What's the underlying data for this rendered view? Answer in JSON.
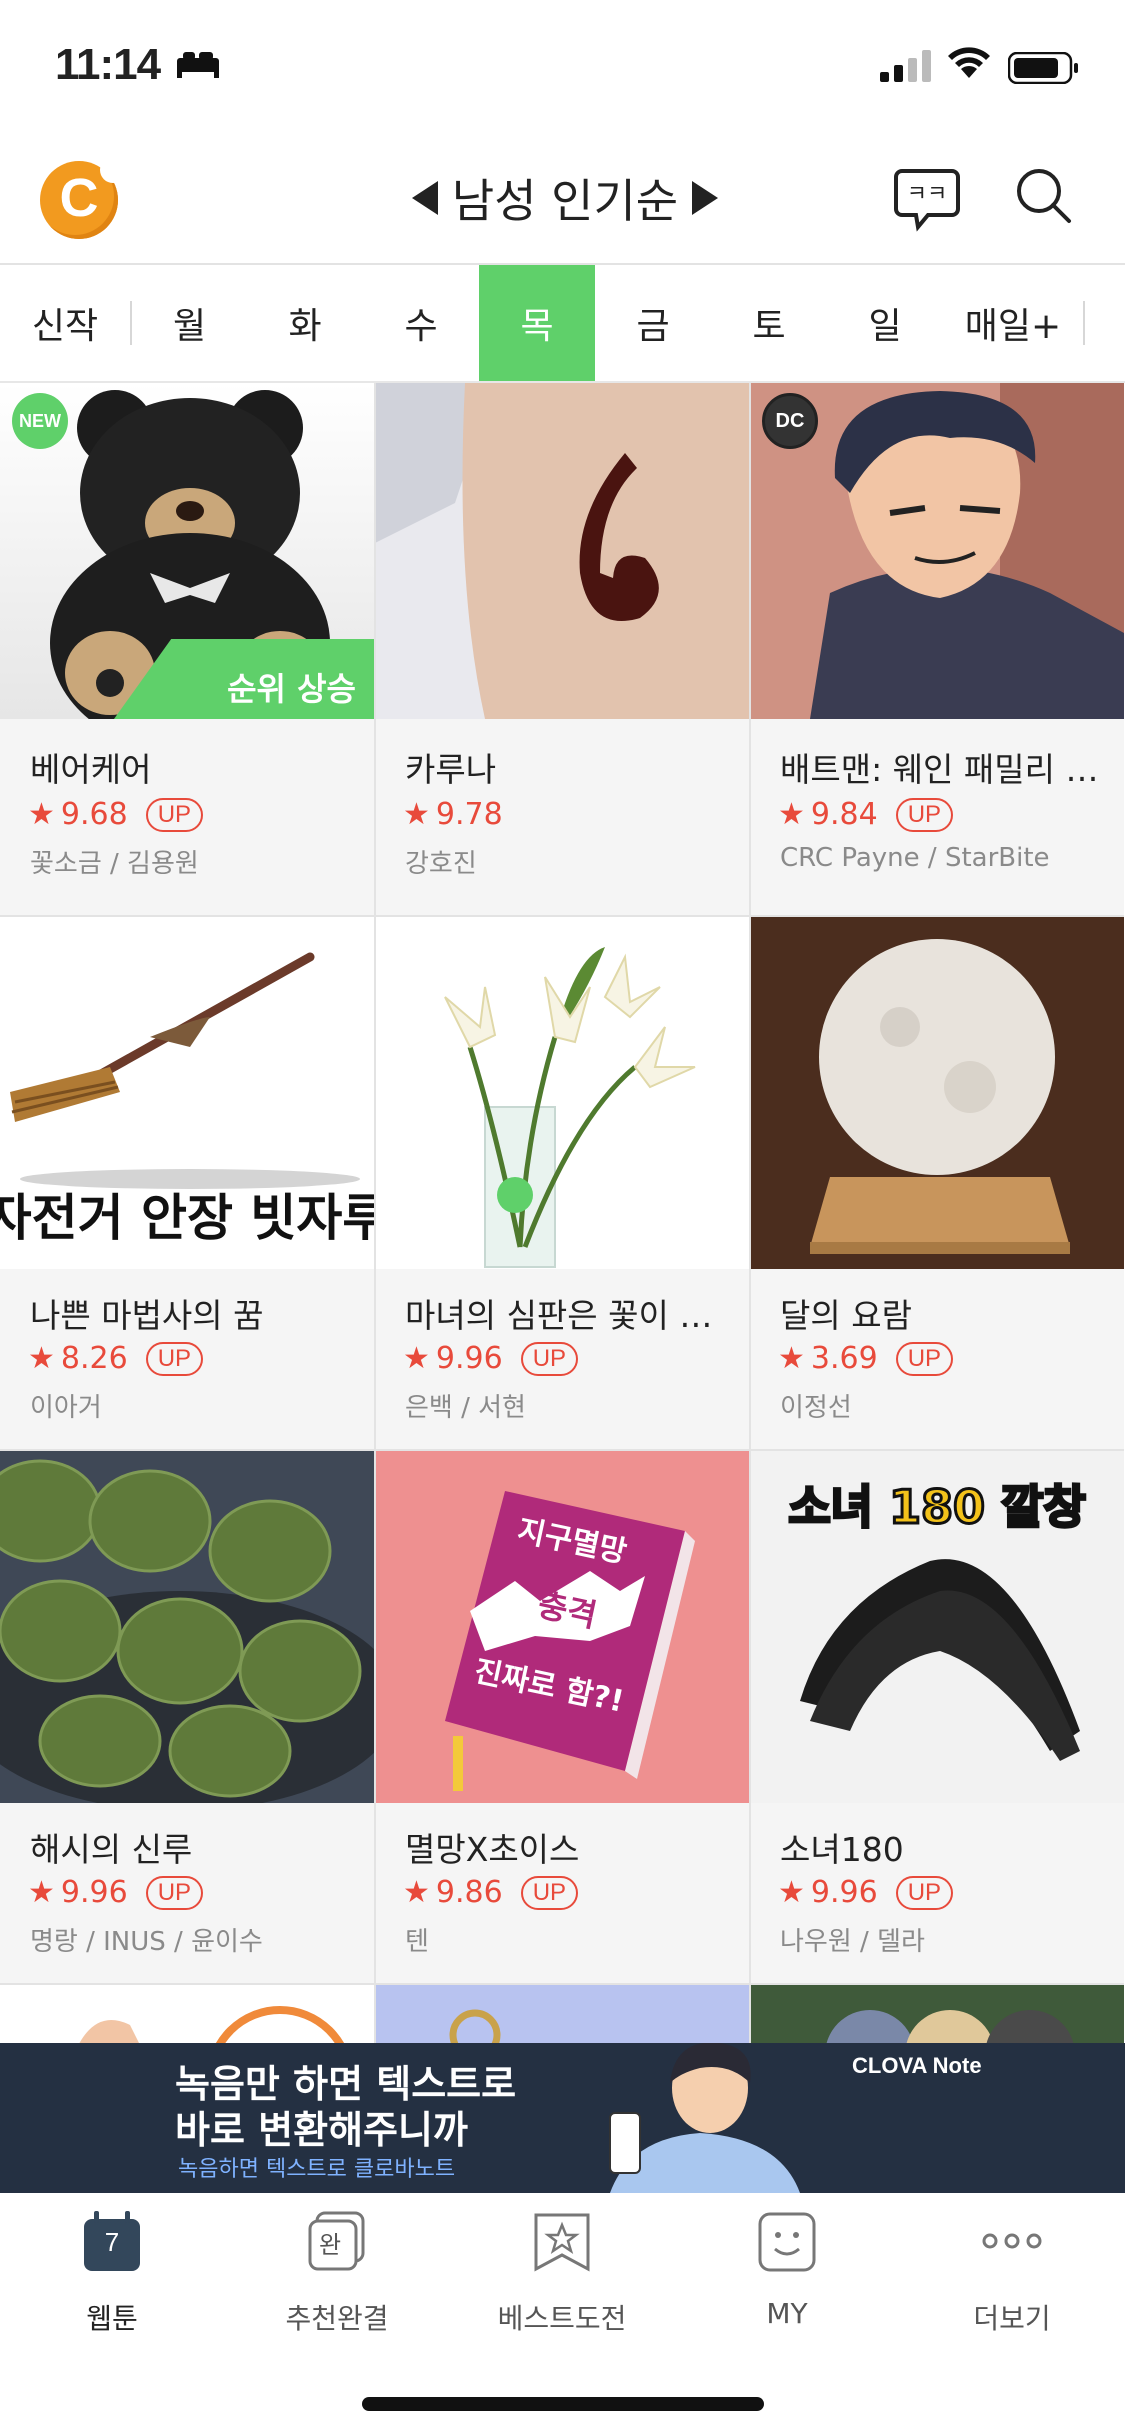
{
  "status_bar": {
    "time": "11:14"
  },
  "header": {
    "title": "남성 인기순"
  },
  "tabs": [
    {
      "label": "신작",
      "active": false
    },
    {
      "label": "월",
      "active": false
    },
    {
      "label": "화",
      "active": false
    },
    {
      "label": "수",
      "active": false
    },
    {
      "label": "목",
      "active": true
    },
    {
      "label": "금",
      "active": false
    },
    {
      "label": "토",
      "active": false
    },
    {
      "label": "일",
      "active": false
    },
    {
      "label": "매일+",
      "active": false
    }
  ],
  "webtoons": [
    {
      "title": "베어케어",
      "rating": "9.68",
      "up": "UP",
      "author": "꽃소금 / 김용원",
      "badge_new": "NEW",
      "rank_up": "순위 상승"
    },
    {
      "title": "카루나",
      "rating": "9.78",
      "up": "",
      "author": "강호진"
    },
    {
      "title": "배트맨: 웨인 패밀리 어드벤처",
      "rating": "9.84",
      "up": "UP",
      "author": "CRC Payne / StarBite",
      "logo": "DC"
    },
    {
      "title": "나쁜 마법사의 꿈",
      "rating": "8.26",
      "up": "UP",
      "author": "이아거",
      "thumb_text": "자전거 안장 빗자루"
    },
    {
      "title": "마녀의 심판은 꽃이 된다",
      "rating": "9.96",
      "up": "UP",
      "author": "은백 / 서현"
    },
    {
      "title": "달의 요람",
      "rating": "3.69",
      "up": "UP",
      "author": "이정선"
    },
    {
      "title": "해시의 신루",
      "rating": "9.96",
      "up": "UP",
      "author": "명랑 / INUS / 윤이수"
    },
    {
      "title": "멸망X초이스",
      "rating": "9.86",
      "up": "UP",
      "author": "텐",
      "thumb_lines": [
        "지구멸망",
        "충격",
        "진짜로 함?!"
      ]
    },
    {
      "title": "소녀180",
      "rating": "9.96",
      "up": "UP",
      "author": "나우원 / 델라",
      "thumb_text": "소녀 180 깔창"
    }
  ],
  "ad": {
    "line1": "녹음만 하면 텍스트로",
    "line2": "바로 변환해주니까",
    "line3": "녹음하면 텍스트로 클로바노트",
    "brand": "CLOVA Note"
  },
  "bottom_nav": [
    {
      "label": "웹툰",
      "icon": "calendar-icon",
      "badge": "7"
    },
    {
      "label": "추천완결",
      "icon": "complete-icon",
      "badge": "완"
    },
    {
      "label": "베스트도전",
      "icon": "bookmark-star-icon"
    },
    {
      "label": "MY",
      "icon": "smile-icon"
    },
    {
      "label": "더보기",
      "icon": "more-dots-icon"
    }
  ],
  "colors": {
    "accent": "#5fd06a",
    "rating": "#e84a3b",
    "ad_bg": "#243042"
  }
}
